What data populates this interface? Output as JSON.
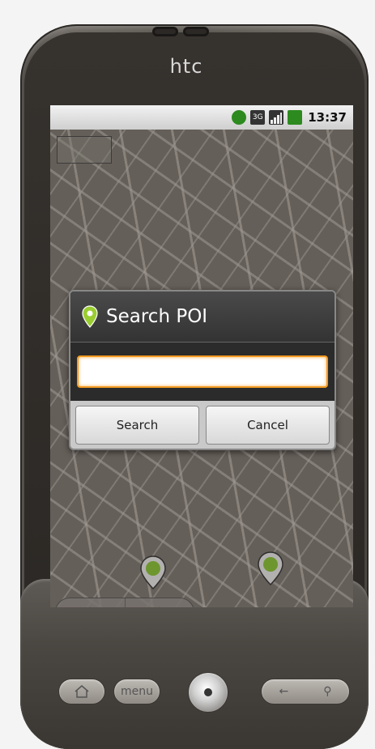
{
  "device": {
    "brand": "htc"
  },
  "status_bar": {
    "time": "13:37",
    "network_label": "3G",
    "icons": [
      "sync-icon",
      "3g-icon",
      "signal-icon",
      "battery-icon"
    ]
  },
  "dialog": {
    "title": "Search POI",
    "input_value": "",
    "buttons": {
      "search": "Search",
      "cancel": "Cancel"
    },
    "accent_color": "#f39a21"
  },
  "hardware_buttons": {
    "menu": "menu"
  }
}
